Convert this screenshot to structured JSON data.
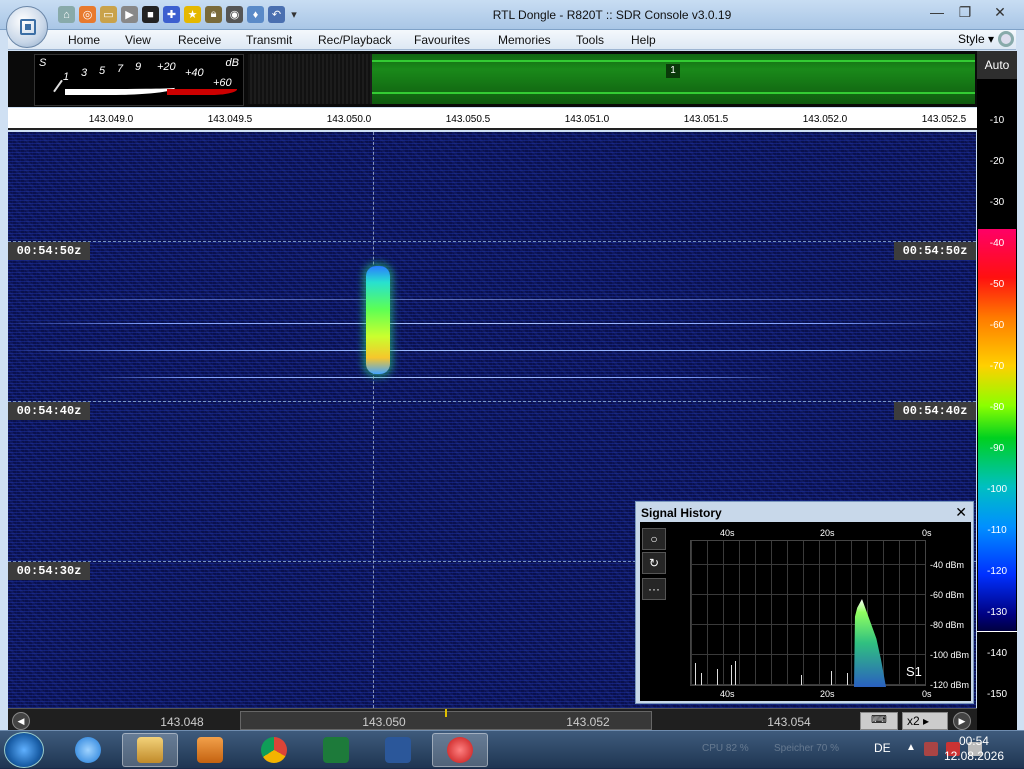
{
  "window": {
    "title": "RTL Dongle - R820T :: SDR Console v3.0.19"
  },
  "quick_access": [
    "home-icon",
    "lifebuoy-icon",
    "folder-icon",
    "play-icon",
    "stop-icon",
    "compass-icon",
    "star-icon",
    "lock-icon",
    "camera-icon",
    "drop-icon",
    "undo-icon",
    "dropdown-icon"
  ],
  "menu": {
    "items": [
      "Home",
      "View",
      "Receive",
      "Transmit",
      "Rec/Playback",
      "Favourites",
      "Memories",
      "Tools",
      "Help"
    ],
    "style_label": "Style"
  },
  "smeter": {
    "s_label": "S",
    "db_label": "dB",
    "scale": [
      "1",
      "3",
      "5",
      "7",
      "9",
      "+20",
      "+40",
      "+60"
    ]
  },
  "spectrum": {
    "channel_label": "1"
  },
  "freq_ruler": [
    "143.049.0",
    "143.049.5",
    "143.050.0",
    "143.050.5",
    "143.051.0",
    "143.051.5",
    "143.052.0",
    "143.052.5"
  ],
  "waterfall": {
    "time_markers": [
      "00:54:50z",
      "00:54:40z",
      "00:54:30z"
    ]
  },
  "scale": {
    "auto_label": "Auto",
    "levels": [
      "-10",
      "-20",
      "-30",
      "-40",
      "-50",
      "-60",
      "-70",
      "-80",
      "-90",
      "-100",
      "-110",
      "-120",
      "-130",
      "-140",
      "-150"
    ]
  },
  "signal_history": {
    "title": "Signal History",
    "close": "✕",
    "buttons": [
      "○",
      "↻",
      "···"
    ],
    "time_top": [
      "40s",
      "20s",
      "0s"
    ],
    "time_bottom": [
      "40s",
      "20s",
      "0s"
    ],
    "levels": [
      "-40 dBm",
      "-60 dBm",
      "-80 dBm",
      "-100 dBm",
      "-120 dBm"
    ],
    "s_reading": "S1"
  },
  "tuner": {
    "labels": [
      "143.048",
      "143.050",
      "143.052",
      "143.054"
    ],
    "zoom": "x2"
  },
  "taskbar": {
    "lang": "DE",
    "time": "00:54",
    "date": "12.08.2026",
    "dim_text_1": "CPU 82 %",
    "dim_text_2": "Speicher 70 %"
  }
}
